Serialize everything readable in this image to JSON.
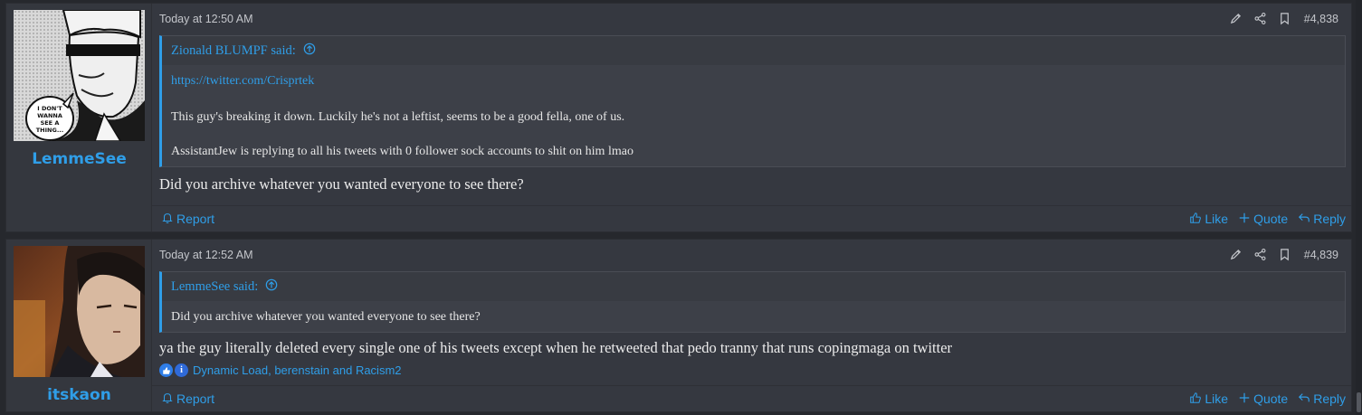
{
  "posts": [
    {
      "username": "LemmeSee",
      "time": "Today at 12:50 AM",
      "post_number": "#4,838",
      "quote": {
        "author": "Zionald BLUMPF said:",
        "link": "https://twitter.com/Crisprtek",
        "lines": [
          "This guy's breaking it down. Luckily he's not a leftist, seems to be a good fella, one of us.",
          "AssistantJew is replying to all his tweets with 0 follower sock accounts to shit on him lmao"
        ]
      },
      "message": "Did you archive whatever you wanted everyone to see there?",
      "avatar_caption": [
        "I DON'T",
        "WANNA",
        "SEE A",
        "THING..."
      ]
    },
    {
      "username": "itskaon",
      "time": "Today at 12:52 AM",
      "post_number": "#4,839",
      "quote": {
        "author": "LemmeSee said:",
        "lines": [
          "Did you archive whatever you wanted everyone to see there?"
        ]
      },
      "message": "ya the guy literally deleted every single one of his tweets except when he retweeted that pedo tranny that runs copingmaga on twitter",
      "reactions_text": "Dynamic Load, berenstain and Racism2"
    }
  ],
  "actions": {
    "report": "Report",
    "like": "Like",
    "quote": "Quote",
    "reply": "Reply"
  },
  "colors": {
    "accent": "#2f9ee8",
    "background": "#26282d",
    "post_bg": "#353840"
  },
  "icons": [
    "edit-icon",
    "share-icon",
    "bookmark-icon",
    "bell-icon",
    "thumbs-up-icon",
    "plus-icon",
    "reply-icon",
    "arrow-up-circle-icon",
    "like-reaction-icon",
    "info-reaction-icon"
  ]
}
